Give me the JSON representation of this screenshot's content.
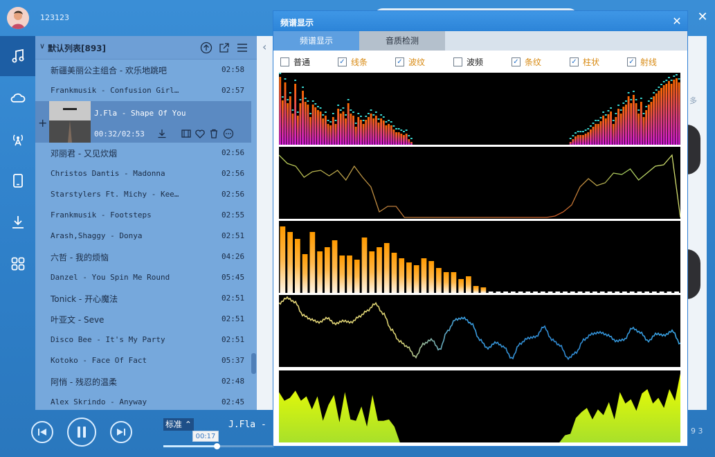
{
  "user": {
    "name": "123123"
  },
  "nav": {
    "items": [
      {
        "icon": "music-note-icon",
        "active": true
      },
      {
        "icon": "cloud-icon",
        "active": false
      },
      {
        "icon": "radio-icon",
        "active": false
      },
      {
        "icon": "phone-icon",
        "active": false
      },
      {
        "icon": "download-icon",
        "active": false
      },
      {
        "icon": "apps-grid-icon",
        "active": false
      }
    ]
  },
  "playlist": {
    "title": "默认列表[893]",
    "songs_above": [
      {
        "title": "新疆美丽公主组合 - 欢乐地跳吧",
        "duration": "02:58",
        "cjk": true
      },
      {
        "title": "Frankmusik - Confusion Girl…",
        "duration": "02:57",
        "cjk": false
      }
    ],
    "now_playing": {
      "title": "J.Fla - Shape Of You",
      "time": "00:32/02:53"
    },
    "songs_below": [
      {
        "title": "邓丽君 - 又见炊烟",
        "duration": "02:56",
        "cjk": true
      },
      {
        "title": "Christos Dantis - Madonna",
        "duration": "02:56",
        "cjk": false
      },
      {
        "title": "Starstylers Ft. Michy - Kee…",
        "duration": "02:56",
        "cjk": false
      },
      {
        "title": "Frankmusik - Footsteps",
        "duration": "02:55",
        "cjk": false
      },
      {
        "title": "Arash,Shaggy - Donya",
        "duration": "02:51",
        "cjk": false
      },
      {
        "title": "六哲 - 我的烦恼",
        "duration": "04:26",
        "cjk": true
      },
      {
        "title": "Danzel - You Spin Me Round",
        "duration": "05:45",
        "cjk": false
      },
      {
        "title": "Tonick - 开心魔法",
        "duration": "02:51",
        "cjk": true
      },
      {
        "title": "叶亚文 - Seve",
        "duration": "02:51",
        "cjk": true
      },
      {
        "title": "Disco Bee - It's My Party",
        "duration": "02:51",
        "cjk": false
      },
      {
        "title": "Kotoko - Face Of Fact",
        "duration": "05:37",
        "cjk": false
      },
      {
        "title": "阿悄 - 残忍的温柔",
        "duration": "02:48",
        "cjk": true
      },
      {
        "title": "Alex Skrindo - Anyway",
        "duration": "02:45",
        "cjk": false
      }
    ]
  },
  "player": {
    "quality": "标准",
    "title": "J.Fla -",
    "position_tip": "00:17",
    "progress": 0.48,
    "bg_number": "9 3",
    "bg_more": "多"
  },
  "dialog": {
    "title": "频谱显示",
    "tabs": [
      "频谱显示",
      "音质检测"
    ],
    "options": [
      {
        "label": "普通",
        "checked": false
      },
      {
        "label": "线条",
        "checked": true
      },
      {
        "label": "波纹",
        "checked": true
      },
      {
        "label": "波频",
        "checked": false
      },
      {
        "label": "条纹",
        "checked": true
      },
      {
        "label": "柱状",
        "checked": true
      },
      {
        "label": "射线",
        "checked": true
      }
    ]
  },
  "viz": {
    "spectrum": [
      98,
      64,
      90,
      60,
      70,
      45,
      88,
      42,
      60,
      78,
      62,
      58,
      40,
      58,
      54,
      50,
      48,
      38,
      42,
      30,
      28,
      40,
      30,
      52,
      45,
      48,
      38,
      60,
      45,
      42,
      26,
      40,
      36,
      30,
      36,
      40,
      45,
      38,
      42,
      32,
      38,
      35,
      28,
      30,
      28,
      22,
      18,
      18,
      16,
      14,
      16,
      8,
      4,
      0,
      0,
      0,
      0,
      0,
      0,
      0,
      0,
      0,
      0,
      0,
      0,
      0,
      0,
      0,
      0,
      0,
      0,
      0,
      0,
      0,
      0,
      0,
      0,
      0,
      0,
      0,
      0,
      0,
      0,
      0,
      0,
      0,
      0,
      0,
      0,
      0,
      0,
      0,
      0,
      0,
      0,
      0,
      0,
      0,
      0,
      0,
      0,
      0,
      0,
      0,
      0,
      0,
      0,
      0,
      0,
      0,
      0,
      0,
      0,
      0,
      0,
      4,
      8,
      12,
      14,
      14,
      14,
      16,
      18,
      22,
      26,
      30,
      30,
      34,
      42,
      38,
      44,
      48,
      30,
      40,
      52,
      45,
      55,
      58,
      70,
      60,
      72,
      60,
      45,
      62,
      40,
      50,
      58,
      62,
      70,
      74,
      78,
      82,
      86,
      88,
      92,
      88,
      94,
      96,
      90
    ],
    "line": [
      92,
      80,
      76,
      60,
      68,
      70,
      62,
      70,
      56,
      76,
      60,
      46,
      10,
      18,
      18,
      2,
      2,
      2,
      2,
      2,
      2,
      2,
      2,
      2,
      2,
      2,
      2,
      2,
      2,
      2,
      2,
      2,
      2,
      4,
      10,
      20,
      46,
      58,
      48,
      52,
      66,
      64,
      72,
      56,
      66,
      76,
      78,
      92,
      2
    ],
    "stripes": [
      96,
      88,
      78,
      56,
      88,
      60,
      66,
      76,
      54,
      54,
      48,
      80,
      60,
      66,
      72,
      58,
      50,
      44,
      40,
      50,
      46,
      36,
      30,
      30,
      20,
      24,
      10,
      8,
      0,
      0,
      0,
      0,
      0,
      0,
      0,
      0,
      0,
      0,
      0,
      0,
      0,
      0,
      0,
      0,
      0,
      0,
      0,
      0,
      0,
      0,
      0,
      0,
      0,
      0
    ],
    "wave": [
      0.88,
      0.96,
      0.9,
      0.72,
      0.66,
      0.62,
      0.68,
      0.6,
      0.64,
      0.62,
      0.7,
      0.78,
      0.88,
      0.74,
      0.52,
      0.36,
      0.28,
      0.14,
      0.32,
      0.38,
      0.24,
      0.5,
      0.66,
      0.68,
      0.6,
      0.38,
      0.26,
      0.34,
      0.28,
      0.12,
      0.32,
      0.4,
      0.42,
      0.56,
      0.38,
      0.3,
      0.12,
      0.2,
      0.38,
      0.46,
      0.48,
      0.44,
      0.36,
      0.38,
      0.54,
      0.48,
      0.36,
      0.46,
      0.44,
      0.5,
      0.32
    ],
    "area": [
      0.7,
      0.58,
      0.62,
      0.72,
      0.58,
      0.64,
      0.46,
      0.64,
      0.3,
      0.52,
      0.66,
      0.28,
      0.7,
      0.32,
      0.3,
      0.5,
      0.22,
      0.66,
      0.3,
      0.3,
      0.32,
      0.22,
      0,
      0,
      0,
      0,
      0,
      0,
      0,
      0,
      0,
      0,
      0,
      0,
      0,
      0,
      0,
      0,
      0,
      0,
      0,
      0,
      0,
      0,
      0,
      0,
      0,
      0,
      0,
      0,
      0,
      0,
      0.1,
      0.12,
      0.34,
      0.42,
      0.48,
      0.32,
      0.46,
      0.38,
      0.56,
      0.32,
      0.7,
      0.54,
      0.6,
      0.44,
      0.68,
      0.74,
      0.54,
      0.62,
      0.48,
      0.74,
      0.58,
      0.96
    ]
  }
}
